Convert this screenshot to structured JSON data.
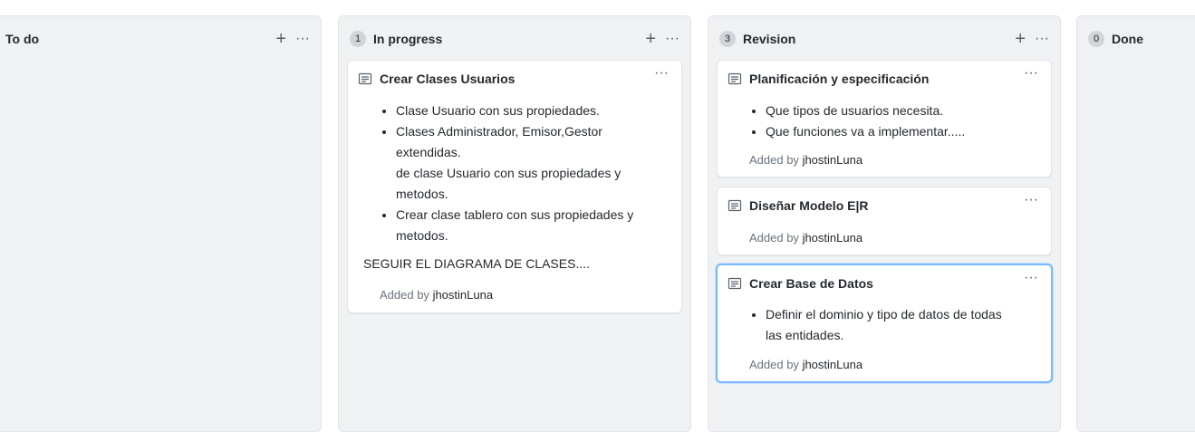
{
  "columns": [
    {
      "title": "To do",
      "count": ""
    },
    {
      "title": "In progress",
      "count": "1"
    },
    {
      "title": "Revision",
      "count": "3"
    },
    {
      "title": "Done",
      "count": "0"
    }
  ],
  "icons": {
    "plus": "+",
    "more": "···"
  },
  "cards": {
    "clases": {
      "title": "Crear Clases Usuarios",
      "items": [
        "Clase Usuario con sus propiedades.",
        "Clases Administrador, Emisor,Gestor extendidas.",
        "de clase Usuario con sus propiedades y metodos.",
        "Crear clase tablero con sus propiedades y metodos."
      ],
      "note": "SEGUIR EL DIAGRAMA DE CLASES....",
      "added_prefix": "Added by",
      "user": "jhostinLuna"
    },
    "planificacion": {
      "title": "Planificación y especificación",
      "items": [
        "Que tipos de usuarios necesita.",
        "Que funciones va a implementar....."
      ],
      "added_prefix": "Added by",
      "user": "jhostinLuna"
    },
    "modelo": {
      "title": "Diseñar Modelo E|R",
      "added_prefix": "Added by",
      "user": "jhostinLuna"
    },
    "base": {
      "title": "Crear Base de Datos",
      "items": [
        "Definir el dominio y tipo de datos de todas las entidades."
      ],
      "added_prefix": "Added by",
      "user": "jhostinLuna"
    }
  }
}
